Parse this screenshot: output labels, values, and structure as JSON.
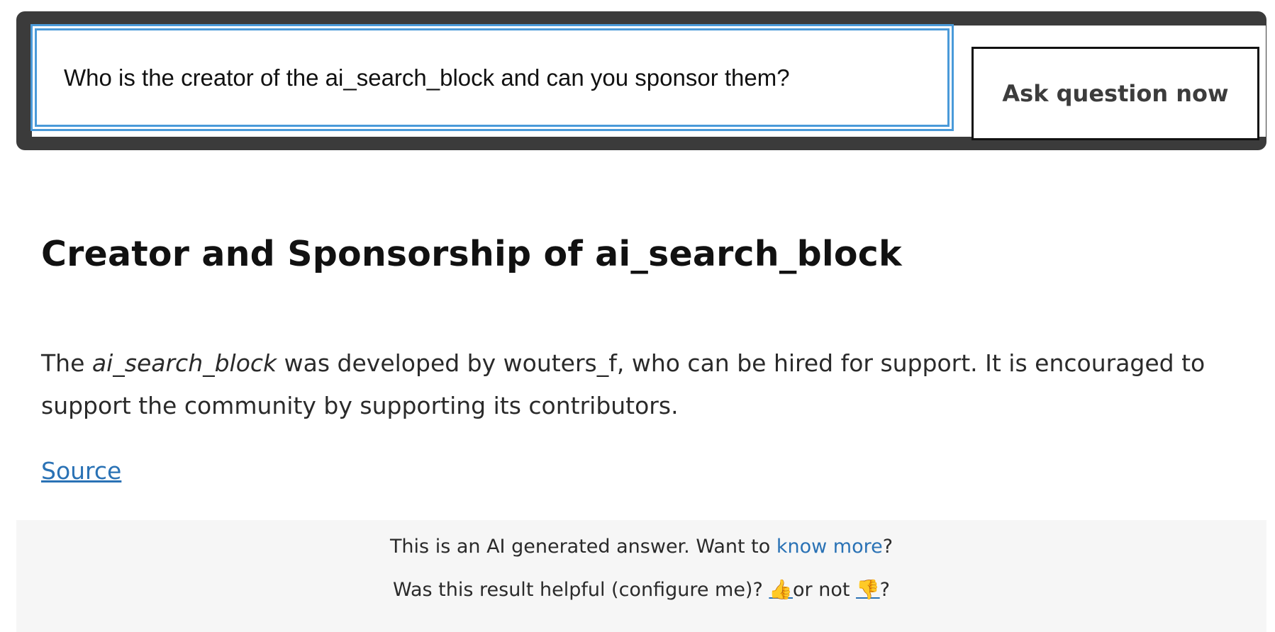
{
  "search": {
    "value": "Who is the creator of the ai_search_block and can you sponsor them?",
    "button_label": "Ask question now"
  },
  "answer": {
    "title": "Creator and Sponsorship of ai_search_block",
    "body_prefix": "The ",
    "body_emphasis": "ai_search_block",
    "body_suffix": " was developed by wouters_f, who can be hired for support. It is encouraged to support the community by supporting its contributors.",
    "source_label": "Source"
  },
  "feedback": {
    "line1_prefix": "This is an AI generated answer. Want to ",
    "line1_link": "know more",
    "line1_suffix": "?",
    "line2_prefix": "Was this result helpful (configure me)? ",
    "thumbs_up": "👍",
    "line2_middle": "or not ",
    "thumbs_down": "👎",
    "line2_suffix": "?"
  },
  "colors": {
    "search_bar_bg": "#3b3b3b",
    "focus_border": "#4a9ad9",
    "link": "#2a72b5",
    "feedback_bg": "#f6f6f6"
  }
}
